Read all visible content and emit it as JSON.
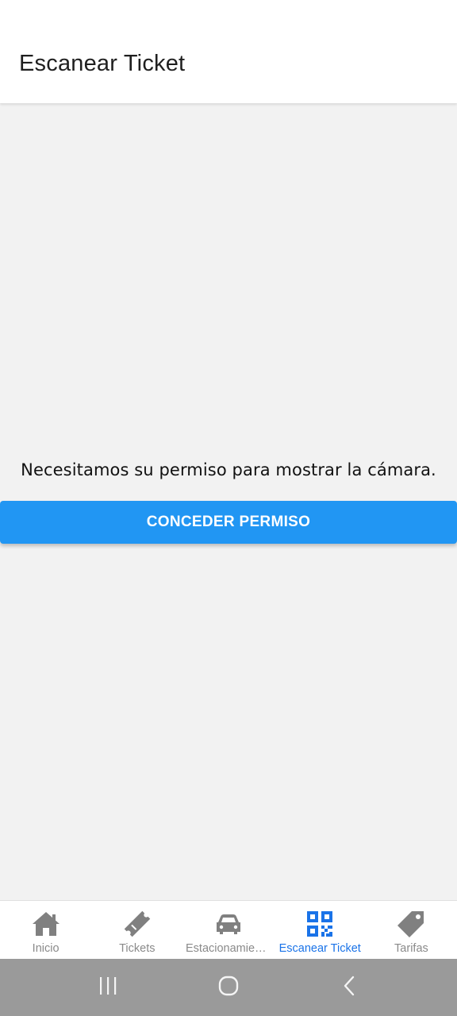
{
  "header": {
    "title": "Escanear Ticket"
  },
  "permission": {
    "message": "Necesitamos su permiso para mostrar la cámara.",
    "button_label": "CONCEDER PERMISO"
  },
  "tabs": [
    {
      "label": "Inicio",
      "icon": "home-icon",
      "active": false
    },
    {
      "label": "Tickets",
      "icon": "ticket-icon",
      "active": false
    },
    {
      "label": "Estacionamientos",
      "icon": "car-icon",
      "active": false
    },
    {
      "label": "Escanear Ticket",
      "icon": "qr-code-icon",
      "active": true
    },
    {
      "label": "Tarifas",
      "icon": "price-tag-icon",
      "active": false
    }
  ],
  "system_nav": {
    "buttons": [
      "recent-apps-icon",
      "home-circle-icon",
      "back-chevron-icon"
    ]
  },
  "colors": {
    "accent": "#2196f3",
    "active_tab": "#1a73e8",
    "inactive_tab": "#8a8a8a",
    "background": "#f2f2f2"
  }
}
